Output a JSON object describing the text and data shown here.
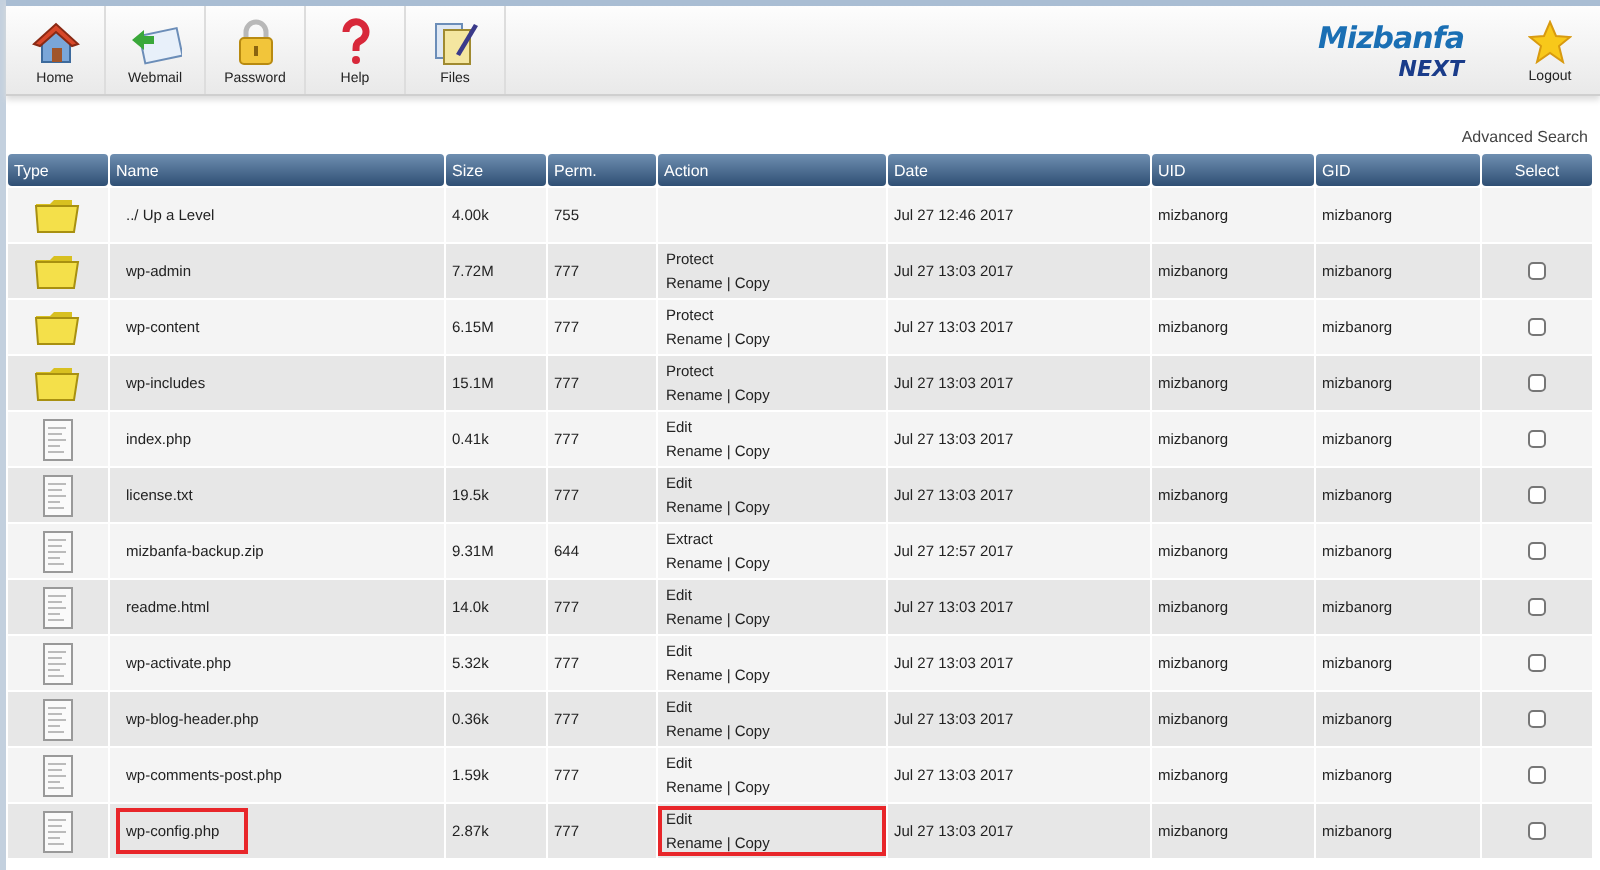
{
  "toolbar": [
    {
      "label": "Home"
    },
    {
      "label": "Webmail"
    },
    {
      "label": "Password"
    },
    {
      "label": "Help"
    },
    {
      "label": "Files"
    }
  ],
  "logo": {
    "name": "Mizbanfa",
    "sub": "NEXT"
  },
  "logout": {
    "label": "Logout"
  },
  "advanced_search": "Advanced Search",
  "table": {
    "columns": [
      "Type",
      "Name",
      "Size",
      "Perm.",
      "Action",
      "Date",
      "UID",
      "GID",
      "Select"
    ],
    "rows": [
      {
        "kind": "folder",
        "name": "../ Up a Level",
        "size": "4.00k",
        "perm": "755",
        "date": "Jul 27 12:46 2017",
        "uid": "mizbanorg",
        "gid": "mizbanorg",
        "highlighted": false
      },
      {
        "kind": "folder",
        "name": "wp-admin",
        "size": "7.72M",
        "perm": "777",
        "action": {
          "main": "Protect",
          "rename": "Rename",
          "separator": "|",
          "copy": "Copy"
        },
        "date": "Jul 27 13:03 2017",
        "uid": "mizbanorg",
        "gid": "mizbanorg",
        "checked": false,
        "highlighted": false
      },
      {
        "kind": "folder",
        "name": "wp-content",
        "size": "6.15M",
        "perm": "777",
        "action": {
          "main": "Protect",
          "rename": "Rename",
          "separator": "|",
          "copy": "Copy"
        },
        "date": "Jul 27 13:03 2017",
        "uid": "mizbanorg",
        "gid": "mizbanorg",
        "checked": false,
        "highlighted": false
      },
      {
        "kind": "folder",
        "name": "wp-includes",
        "size": "15.1M",
        "perm": "777",
        "action": {
          "main": "Protect",
          "rename": "Rename",
          "separator": "|",
          "copy": "Copy"
        },
        "date": "Jul 27 13:03 2017",
        "uid": "mizbanorg",
        "gid": "mizbanorg",
        "checked": false,
        "highlighted": false
      },
      {
        "kind": "file",
        "name": "index.php",
        "size": "0.41k",
        "perm": "777",
        "action": {
          "main": "Edit",
          "rename": "Rename",
          "separator": "|",
          "copy": "Copy"
        },
        "date": "Jul 27 13:03 2017",
        "uid": "mizbanorg",
        "gid": "mizbanorg",
        "checked": false,
        "highlighted": false
      },
      {
        "kind": "file",
        "name": "license.txt",
        "size": "19.5k",
        "perm": "777",
        "action": {
          "main": "Edit",
          "rename": "Rename",
          "separator": "|",
          "copy": "Copy"
        },
        "date": "Jul 27 13:03 2017",
        "uid": "mizbanorg",
        "gid": "mizbanorg",
        "checked": false,
        "highlighted": false
      },
      {
        "kind": "file",
        "name": "mizbanfa-backup.zip",
        "size": "9.31M",
        "perm": "644",
        "action": {
          "main": "Extract",
          "rename": "Rename",
          "separator": "|",
          "copy": "Copy"
        },
        "date": "Jul 27 12:57 2017",
        "uid": "mizbanorg",
        "gid": "mizbanorg",
        "checked": false,
        "highlighted": false
      },
      {
        "kind": "file",
        "name": "readme.html",
        "size": "14.0k",
        "perm": "777",
        "action": {
          "main": "Edit",
          "rename": "Rename",
          "separator": "|",
          "copy": "Copy"
        },
        "date": "Jul 27 13:03 2017",
        "uid": "mizbanorg",
        "gid": "mizbanorg",
        "checked": false,
        "highlighted": false
      },
      {
        "kind": "file",
        "name": "wp-activate.php",
        "size": "5.32k",
        "perm": "777",
        "action": {
          "main": "Edit",
          "rename": "Rename",
          "separator": "|",
          "copy": "Copy"
        },
        "date": "Jul 27 13:03 2017",
        "uid": "mizbanorg",
        "gid": "mizbanorg",
        "checked": false,
        "highlighted": false
      },
      {
        "kind": "file",
        "name": "wp-blog-header.php",
        "size": "0.36k",
        "perm": "777",
        "action": {
          "main": "Edit",
          "rename": "Rename",
          "separator": "|",
          "copy": "Copy"
        },
        "date": "Jul 27 13:03 2017",
        "uid": "mizbanorg",
        "gid": "mizbanorg",
        "checked": false,
        "highlighted": false
      },
      {
        "kind": "file",
        "name": "wp-comments-post.php",
        "size": "1.59k",
        "perm": "777",
        "action": {
          "main": "Edit",
          "rename": "Rename",
          "separator": "|",
          "copy": "Copy"
        },
        "date": "Jul 27 13:03 2017",
        "uid": "mizbanorg",
        "gid": "mizbanorg",
        "checked": false,
        "highlighted": false
      },
      {
        "kind": "file",
        "name": "wp-config.php",
        "size": "2.87k",
        "perm": "777",
        "action": {
          "main": "Edit",
          "rename": "Rename",
          "separator": "|",
          "copy": "Copy"
        },
        "date": "Jul 27 13:03 2017",
        "uid": "mizbanorg",
        "gid": "mizbanorg",
        "checked": false,
        "highlighted": true
      }
    ]
  }
}
